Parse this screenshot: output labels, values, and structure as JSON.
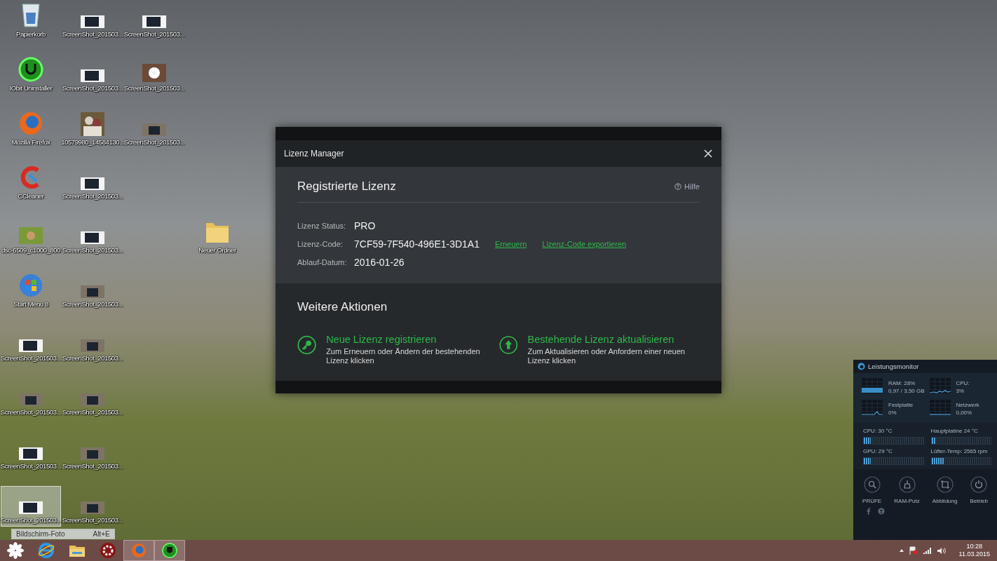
{
  "desktop": {
    "columns": [
      [
        {
          "label": "Papierkorb",
          "kind": "trash",
          "selected": false
        },
        {
          "label": "IObit Uninstaller",
          "kind": "uninstaller",
          "selected": false
        },
        {
          "label": "Mozilla Firefox",
          "kind": "browser",
          "selected": false
        },
        {
          "label": "CCleaner",
          "kind": "cleaner",
          "selected": false
        },
        {
          "label": "dsc-6509_c1000_800",
          "kind": "photo",
          "selected": false
        },
        {
          "label": "Start Menu 8",
          "kind": "start-menu",
          "selected": false
        },
        {
          "label": "ScreenShot_201503...",
          "kind": "screenshot",
          "selected": false
        },
        {
          "label": "ScreenShot_201503...",
          "kind": "screenshot-scene",
          "selected": false
        },
        {
          "label": "ScreenShot_201503...",
          "kind": "screenshot",
          "selected": false
        },
        {
          "label": "ScreenShot_201503...",
          "kind": "screenshot",
          "selected": true
        }
      ],
      [
        {
          "label": "ScreenShot_201503...",
          "kind": "screenshot",
          "selected": false
        },
        {
          "label": "ScreenShot_201503...",
          "kind": "screenshot",
          "selected": false
        },
        {
          "label": "10579980_14584130...",
          "kind": "photo-portrait",
          "selected": false
        },
        {
          "label": "ScreenShot_201503...",
          "kind": "screenshot",
          "selected": false
        },
        {
          "label": "ScreenShot_201503...",
          "kind": "screenshot",
          "selected": false
        },
        {
          "label": "ScreenShot_201503...",
          "kind": "screenshot-scene",
          "selected": false
        },
        {
          "label": "ScreenShot_201503...",
          "kind": "screenshot-scene",
          "selected": false
        },
        {
          "label": "ScreenShot_201503...",
          "kind": "screenshot-scene",
          "selected": false
        },
        {
          "label": "ScreenShot_201503...",
          "kind": "screenshot-scene",
          "selected": false
        },
        {
          "label": "ScreenShot_201503...",
          "kind": "screenshot-scene",
          "selected": false
        }
      ],
      [
        {
          "label": "ScreenShot_201503...",
          "kind": "screenshot",
          "selected": false
        },
        {
          "label": "ScreenShot_201503...",
          "kind": "flower-thumb",
          "selected": false
        },
        {
          "label": "ScreenShot_201503...",
          "kind": "screenshot-scene",
          "selected": false
        }
      ]
    ],
    "folder": {
      "label": "Neuer Ordner",
      "kind": "folder",
      "selected": false
    }
  },
  "tooltip": {
    "text": "Bildschirm-Foto",
    "shortcut": "Alt+E"
  },
  "dialog": {
    "title": "Lizenz Manager",
    "section_title": "Registrierte Lizenz",
    "help": "Hilfe",
    "fields": [
      {
        "label": "Lizenz Status:",
        "value": "PRO"
      },
      {
        "label": "Lizenz-Code:",
        "value": "7CF59-7F540-496E1-3D1A1",
        "links": [
          "Erneuern",
          "Lizenz-Code exportieren"
        ]
      },
      {
        "label": "Ablauf-Datum:",
        "value": "2016-01-26"
      }
    ],
    "actions_title": "Weitere Aktionen",
    "actions": [
      {
        "kind": "key",
        "title": "Neue Lizenz registrieren",
        "description": "Zum Erneuern oder Ändern der bestehenden Lizenz klicken"
      },
      {
        "kind": "upgrade",
        "title": "Bestehende Lizenz aktualisieren",
        "description": "Zum Aktualisieren oder Anfordern einer neuen Lizenz klicken"
      }
    ]
  },
  "perf_monitor": {
    "title": "Leistungsmonitor",
    "graphs": [
      {
        "kind": "band",
        "label": "RAM: 28%",
        "detail": "0,97 / 3,50 GB"
      },
      {
        "kind": "line",
        "label": "CPU:",
        "detail": "3%"
      },
      {
        "kind": "spike",
        "label": "Festplatte",
        "detail": "0%"
      },
      {
        "kind": "flat",
        "label": "Netzwerk",
        "detail": "0,00%"
      }
    ],
    "sensors": [
      {
        "label": "CPU: 30 °C",
        "level": 0.12
      },
      {
        "label": "Hauptplatine 24 °C",
        "level": 0.08
      },
      {
        "label": "GPU: 29 °C",
        "level": 0.12
      },
      {
        "label": "Lüfter-Temp: 2565 rpm",
        "level": 0.22
      }
    ],
    "buttons": [
      {
        "kind": "scan",
        "label": "PRÜFE"
      },
      {
        "kind": "clean",
        "label": "RAM-Putz"
      },
      {
        "kind": "capture",
        "label": "Abbildung"
      },
      {
        "kind": "power",
        "label": "Betrieb"
      }
    ]
  },
  "taskbar": {
    "apps": [
      {
        "kind": "flower",
        "running": false
      },
      {
        "kind": "ie",
        "running": false
      },
      {
        "kind": "explorer",
        "running": false
      },
      {
        "kind": "gear",
        "running": false
      },
      {
        "kind": "firefox",
        "running": true
      },
      {
        "kind": "shield",
        "running": true
      }
    ],
    "time": "10:28",
    "date": "11.03.2015"
  }
}
